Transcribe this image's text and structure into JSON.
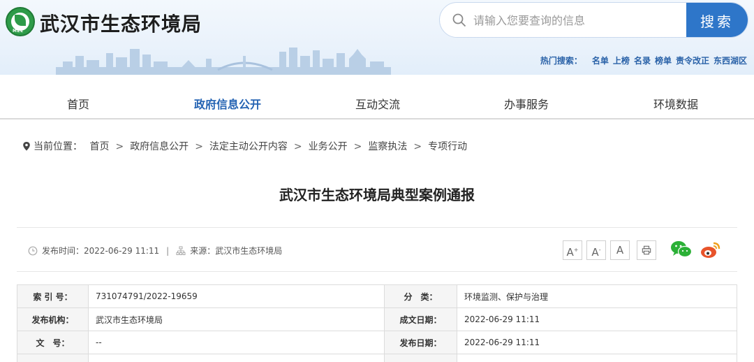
{
  "header": {
    "site_title": "武汉市生态环境局",
    "logo_text": "MEE",
    "search_placeholder": "请输入您要查询的信息",
    "search_button": "搜索",
    "hot_label": "热门搜索：",
    "hot_terms": [
      "名单",
      "上榜",
      "名录",
      "榜单",
      "责令改正",
      "东西湖区"
    ]
  },
  "nav": {
    "items": [
      "首页",
      "政府信息公开",
      "互动交流",
      "办事服务",
      "环境数据"
    ],
    "active_index": 1
  },
  "breadcrumb": {
    "label": "当前位置：",
    "items": [
      "首页",
      "政府信息公开",
      "法定主动公开内容",
      "业务公开",
      "监察执法",
      "专项行动"
    ],
    "separator": ">"
  },
  "article": {
    "title": "武汉市生态环境局典型案例通报",
    "publish_time_label": "发布时间：",
    "publish_time": "2022-06-29 11:11",
    "source_label": "来源：",
    "source": "武汉市生态环境局",
    "font_buttons": [
      "A",
      "A",
      "A"
    ],
    "font_button_sups": [
      "+",
      "-",
      ""
    ]
  },
  "info_table": {
    "rows": [
      {
        "k1": "索 引 号：",
        "v1": "731074791/2022-19659",
        "k2": "分　类：",
        "v2": "环境监测、保护与治理"
      },
      {
        "k1": "发布机构：",
        "v1": "武汉市生态环境局",
        "k2": "成文日期：",
        "v2": "2022-06-29 11:11"
      },
      {
        "k1": "文　号：",
        "v1": "--",
        "k2": "发布日期：",
        "v2": "2022-06-29 11:11"
      }
    ]
  },
  "colors": {
    "brand_blue": "#2e76c9",
    "nav_active": "#2463b3",
    "logo_green": "#2e9b49",
    "wechat_green": "#2bb036",
    "weibo_orange": "#e8542b"
  },
  "icons": [
    "logo-emblem-icon",
    "search-icon",
    "location-pin-icon",
    "clock-icon",
    "source-icon",
    "print-icon",
    "wechat-icon",
    "weibo-icon"
  ]
}
